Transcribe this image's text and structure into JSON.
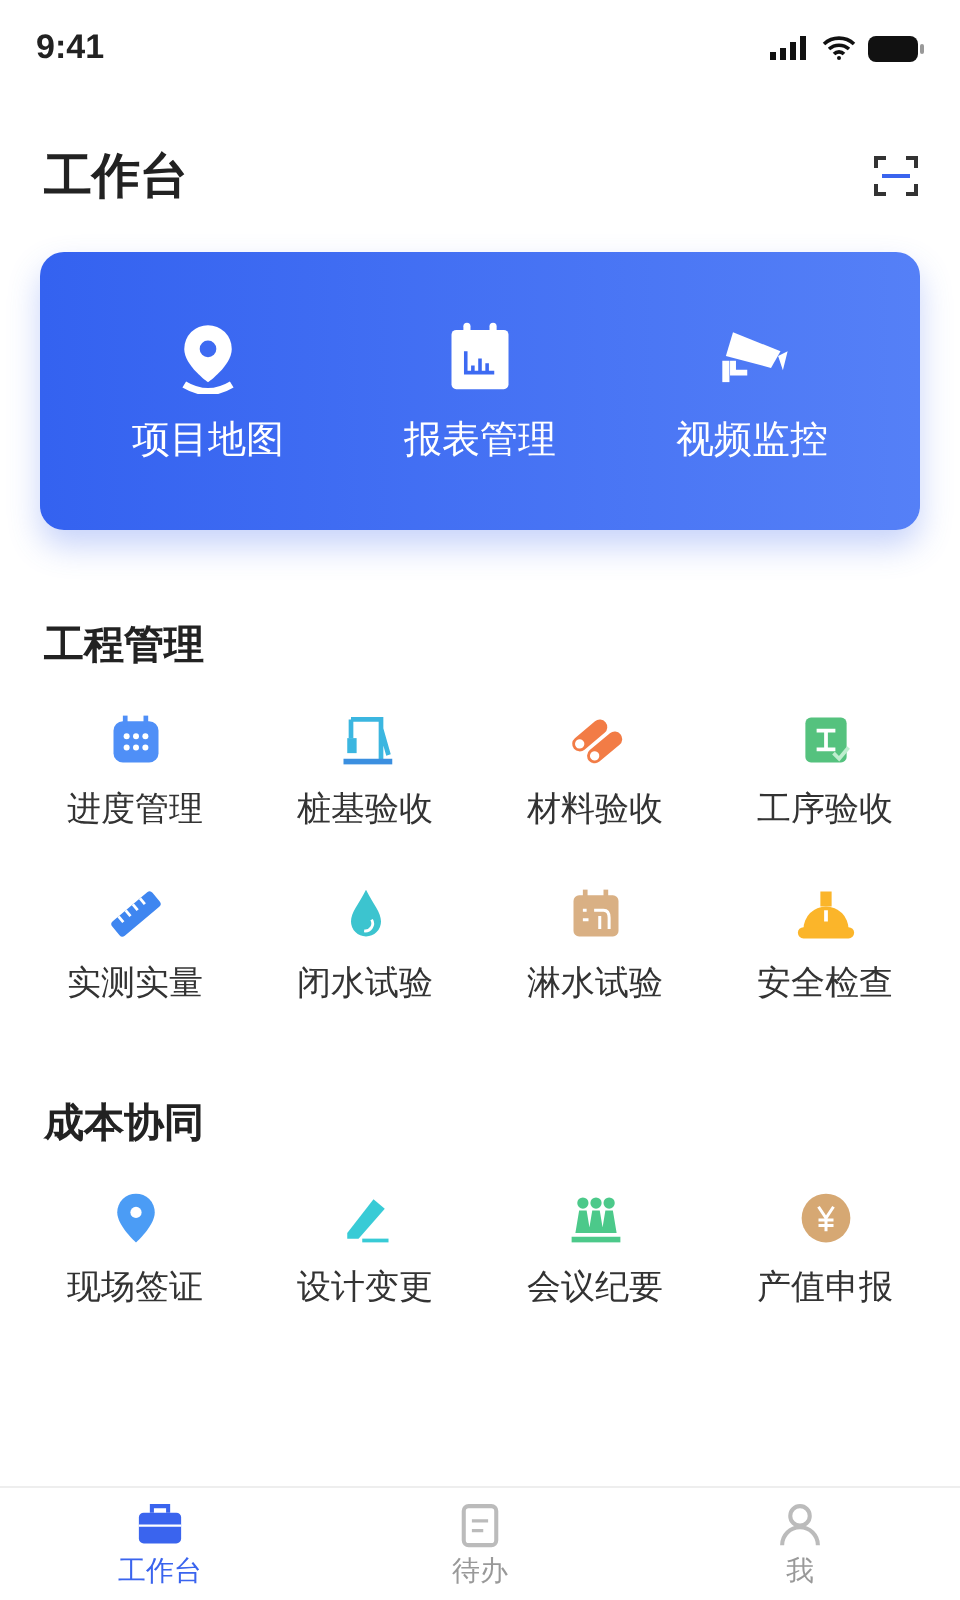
{
  "status_bar": {
    "time": "9:41"
  },
  "header": {
    "title": "工作台"
  },
  "banner": [
    {
      "label": "项目地图"
    },
    {
      "label": "报表管理"
    },
    {
      "label": "视频监控"
    }
  ],
  "sections": [
    {
      "title": "工程管理",
      "items": [
        {
          "label": "进度管理"
        },
        {
          "label": "桩基验收"
        },
        {
          "label": "材料验收"
        },
        {
          "label": "工序验收"
        },
        {
          "label": "实测实量"
        },
        {
          "label": "闭水试验"
        },
        {
          "label": "淋水试验"
        },
        {
          "label": "安全检查"
        }
      ]
    },
    {
      "title": "成本协同",
      "items": [
        {
          "label": "现场签证"
        },
        {
          "label": "设计变更"
        },
        {
          "label": "会议纪要"
        },
        {
          "label": "产值申报"
        }
      ]
    }
  ],
  "tab_bar": [
    {
      "label": "工作台",
      "selected": true
    },
    {
      "label": "待办",
      "selected": false
    },
    {
      "label": "我",
      "selected": false
    }
  ]
}
